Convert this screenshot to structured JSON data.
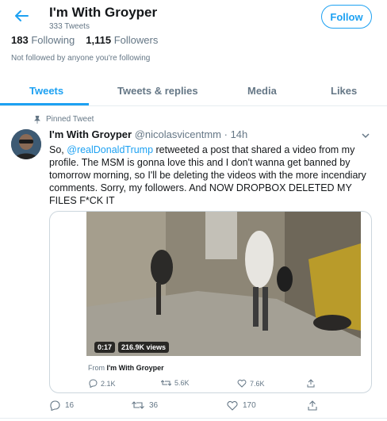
{
  "header": {
    "title": "I'm With Groyper",
    "tweet_count": "333 Tweets",
    "follow_label": "Follow"
  },
  "profile": {
    "following_count": "183",
    "following_label": "Following",
    "followers_count": "1,115",
    "followers_label": "Followers",
    "not_followed": "Not followed by anyone you're following"
  },
  "tabs": [
    {
      "label": "Tweets",
      "active": true
    },
    {
      "label": "Tweets & replies",
      "active": false
    },
    {
      "label": "Media",
      "active": false
    },
    {
      "label": "Likes",
      "active": false
    }
  ],
  "tweet": {
    "pinned_label": "Pinned Tweet",
    "display_name": "I'm With Groyper",
    "handle_time": "@nicolasvicentmm · 14h",
    "text_prefix": "So, ",
    "mention": "@realDonaldTrump",
    "text_body": " retweeted a post that shared a video from my profile. The MSM is gonna love this and I don't wanna get banned by tomorrow morning, so I'll be deleting the videos with the more incendiary comments. Sorry, my followers. And NOW DROPBOX DELETED MY FILES F*CK IT",
    "card": {
      "video_time": "0:17",
      "video_views": "216.9K views",
      "from_prefix": "From",
      "from_name": "I'm With Groyper",
      "replies": "2.1K",
      "retweets": "5.6K",
      "likes": "7.6K"
    },
    "replies": "16",
    "retweets": "36",
    "likes": "170"
  },
  "colors": {
    "accent": "#1da1f2",
    "muted": "#657786"
  }
}
